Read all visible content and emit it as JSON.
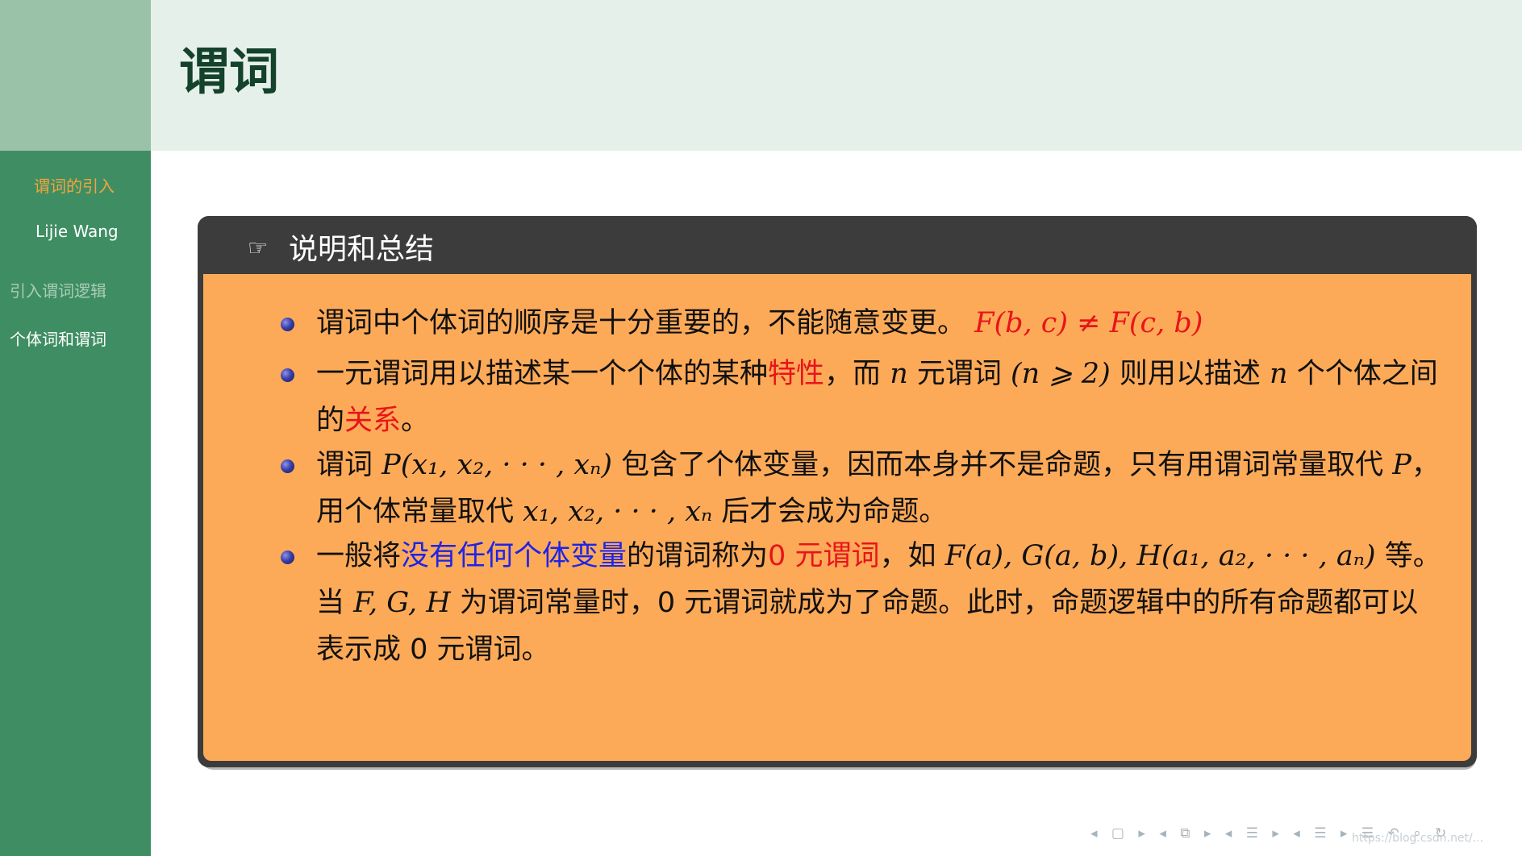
{
  "sidebar": {
    "title": "谓词的引入",
    "author": "Lijie Wang",
    "sections": [
      "引入谓词逻辑",
      "个体词和谓词"
    ]
  },
  "frame": {
    "title": "谓词"
  },
  "block": {
    "icon": "pointing-hand-icon",
    "title": "说明和总结",
    "items": [
      {
        "a": "谓词中个体词的顺序是十分重要的，不能随意变更。",
        "formula": "F(b, c) ≠ F(c, b)"
      },
      {
        "a": "一元谓词用以描述某一个个体的某种",
        "red1": "特性",
        "b": "，而",
        "n1": "n",
        "c": "元谓词",
        "cond": "(n ⩾ 2)",
        "d": "则用以描述",
        "n2": "n",
        "e": "个个体之间的",
        "red2": "关系",
        "f": "。"
      },
      {
        "a": "谓词",
        "p1": "P(x₁, x₂, · · · , xₙ)",
        "b": "包含了个体变量，因而本身并不是命题，只有用谓词常量取代",
        "p2": "P",
        "c": "，用个体常量取代",
        "xs": "x₁, x₂, · · · , xₙ",
        "d": "后才会成为命题。"
      },
      {
        "a": "一般将",
        "blue": "没有任何个体变量",
        "b": "的谓词称为",
        "red": "0 元谓词",
        "c": "，如",
        "examples": "F(a), G(a, b), H(a₁, a₂, · · · , aₙ)",
        "d": "等。当",
        "fgh": "F, G, H",
        "e": "为谓词常量时，0 元谓词就成为了命题。此时，命题逻辑中的所有命题都可以表示成 0 元谓词。"
      }
    ]
  },
  "nav": {
    "symbols": "◂ ▢ ▸ ◂ ⧉ ▸ ◂ ☰ ▸ ◂ ☰ ▸ ☰ ↶ ⌕ ↻",
    "watermark": "https://blog.csdn.net/..."
  }
}
